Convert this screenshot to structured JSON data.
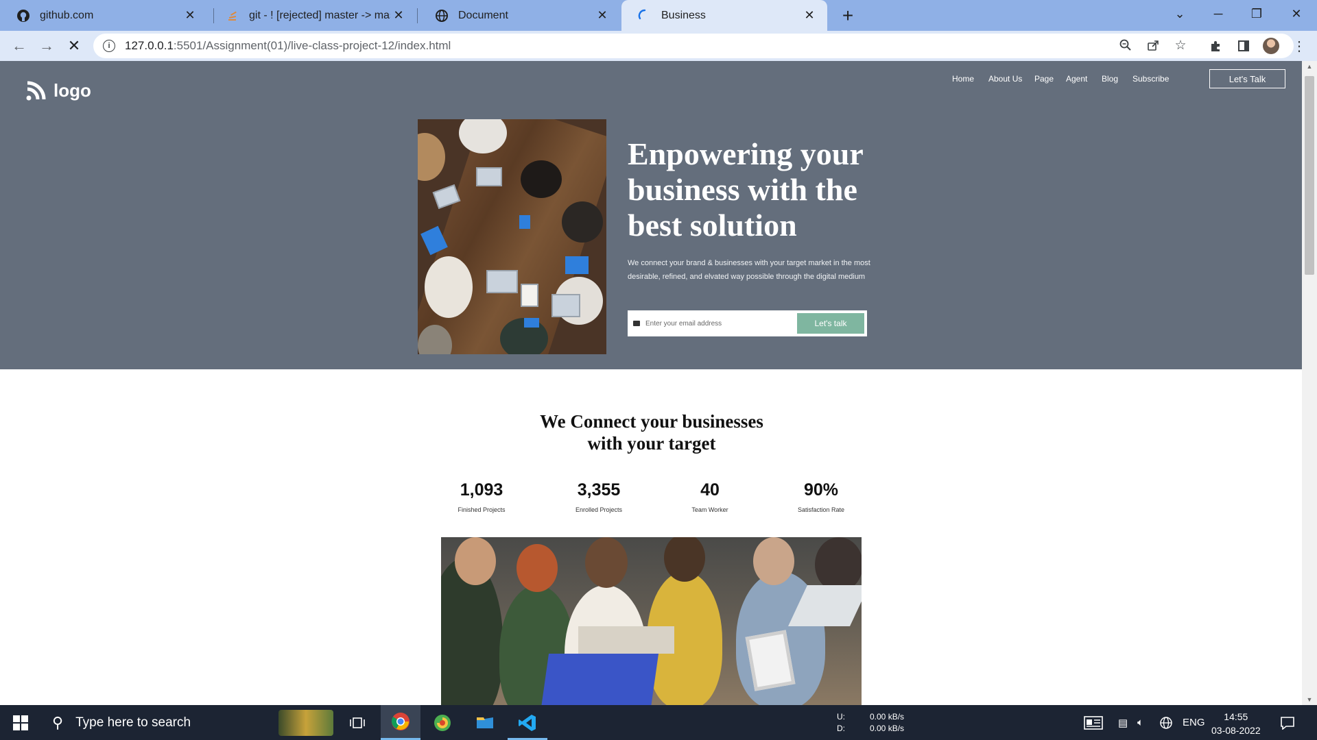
{
  "browser": {
    "tabs": [
      {
        "title": "github.com",
        "icon": "github-icon"
      },
      {
        "title": "git - ! [rejected] master -> maste",
        "icon": "stackoverflow-icon"
      },
      {
        "title": "Document",
        "icon": "globe-icon"
      },
      {
        "title": "Business",
        "icon": "loading-icon",
        "active": true
      }
    ],
    "url_host": "127.0.0.1",
    "url_rest": ":5501/Assignment(01)/live-class-project-12/index.html"
  },
  "site": {
    "logo_text": "logo",
    "nav": [
      "Home",
      "About Us",
      "Page",
      "Agent",
      "Blog",
      "Subscribe"
    ],
    "cta": "Let's Talk",
    "hero": {
      "title": "Enpowering your business with the best solution",
      "description": "We connect your brand & businesses with your target market in the most desirable, refined, and elvated way possible through the digital medium",
      "email_placeholder": "Enter your email address",
      "email_button": "Let's talk"
    },
    "section_title_line1": "We Connect your businesses",
    "section_title_line2": "with your target",
    "stats": [
      {
        "value": "1,093",
        "label": "Finished Projects"
      },
      {
        "value": "3,355",
        "label": "Enrolled Projects"
      },
      {
        "value": "40",
        "label": "Team Worker"
      },
      {
        "value": "90%",
        "label": "Satisfaction Rate"
      }
    ]
  },
  "taskbar": {
    "search_placeholder": "Type here to search",
    "net_up_label": "U:",
    "net_down_label": "D:",
    "net_up": "0.00 kB/s",
    "net_down": "0.00 kB/s",
    "language": "ENG",
    "time": "14:55",
    "date": "03-08-2022"
  },
  "colors": {
    "hero_bg": "#646e7c",
    "accent_button": "#7fb6a0",
    "tabbar": "#8fb0e6"
  }
}
